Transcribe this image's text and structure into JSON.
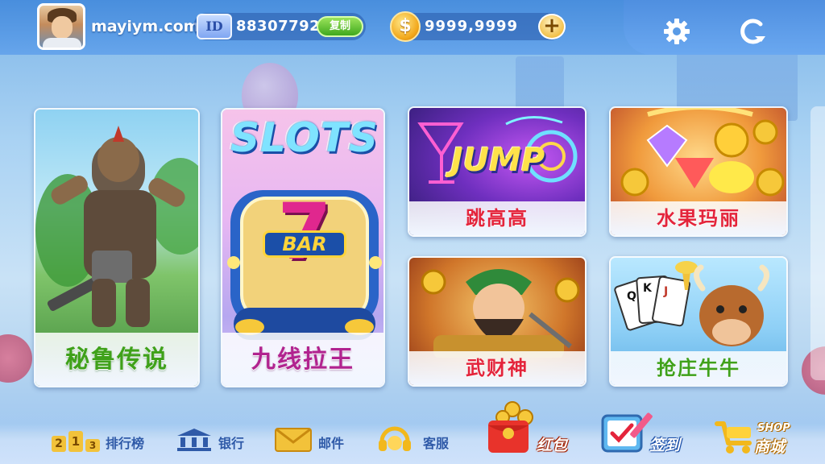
{
  "header": {
    "username": "mayiym.com",
    "id_badge": "ID",
    "id_value": "88307792",
    "copy_label": "复制",
    "coin_symbol": "$",
    "coins": "9999,9999",
    "plus_label": "+"
  },
  "games": [
    {
      "name": "秘鲁传说",
      "accent": "#3fa11a"
    },
    {
      "name": "九线拉王",
      "accent": "#b1238f",
      "art_title": "SLOTS",
      "art_sub": "BAR",
      "art_num": "7"
    },
    {
      "name": "跳高高",
      "accent": "#e4243b",
      "art_title": "JUMP"
    },
    {
      "name": "水果玛丽",
      "accent": "#e4243b"
    },
    {
      "name": "武财神",
      "accent": "#e4243b"
    },
    {
      "name": "抢庄牛牛",
      "accent": "#3fa11a",
      "art_cards": [
        "Q",
        "K",
        "J"
      ]
    }
  ],
  "bottom_nav": {
    "rank_digits": [
      "2",
      "1",
      "3"
    ],
    "rank_label": "排行榜",
    "bank_label": "银行",
    "mail_label": "邮件",
    "service_label": "客服",
    "redpacket_label": "红包",
    "signin_label": "签到",
    "shop_label": "商城",
    "shop_badge": "SHOP"
  },
  "icons": [
    "settings-icon",
    "refresh-icon",
    "coin-icon",
    "rank-icon",
    "bank-icon",
    "mail-icon",
    "service-icon",
    "redpacket-icon",
    "signin-icon",
    "shop-icon"
  ]
}
